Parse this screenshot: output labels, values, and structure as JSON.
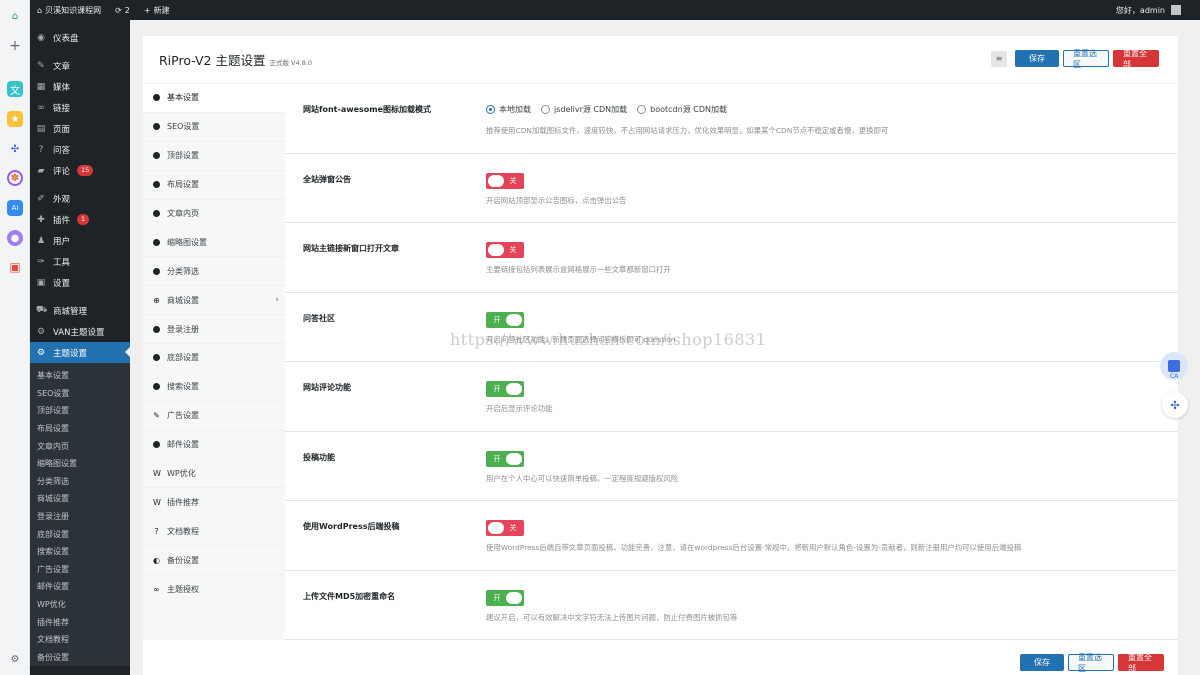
{
  "adminbar": {
    "home_icon": "home-icon",
    "site_name": "贝溪知识课程网",
    "updates_count": "2",
    "new_label": "新建",
    "greeting": "您好，admin"
  },
  "dock": {
    "icons": [
      "home-icon",
      "plus-icon",
      "translate-icon",
      "star-icon",
      "network-icon",
      "palette-icon",
      "ai-icon",
      "chat-icon",
      "game-icon",
      "settings-icon"
    ]
  },
  "menu": {
    "dashboard": "仪表盘",
    "posts": "文章",
    "media": "媒体",
    "links": "链接",
    "pages": "页面",
    "qa": "问答",
    "comments": "评论",
    "comments_badge": "15",
    "appearance": "外观",
    "plugins": "插件",
    "plugins_badge": "1",
    "users": "用户",
    "tools": "工具",
    "settings": "设置",
    "shop": "商城管理",
    "van": "VAN主题设置",
    "theme": "主题设置",
    "submenu": [
      "基本设置",
      "SEO设置",
      "顶部设置",
      "布局设置",
      "文章内页",
      "缩略图设置",
      "分类筛选",
      "商城设置",
      "登录注册",
      "底部设置",
      "搜索设置",
      "广告设置",
      "邮件设置",
      "WP优化",
      "插件推荐",
      "文档教程",
      "备份设置"
    ]
  },
  "panel": {
    "title": "RiPro-V2 主题设置",
    "version": "正式版 V4.8.0",
    "save_label": "保存",
    "reset_section_label": "重置选区",
    "reset_all_label": "重置全部"
  },
  "nav": {
    "items": [
      {
        "label": "基本设置",
        "glyph": "●"
      },
      {
        "label": "SEO设置",
        "glyph": "●"
      },
      {
        "label": "顶部设置",
        "glyph": "●"
      },
      {
        "label": "布局设置",
        "glyph": "●"
      },
      {
        "label": "文章内页",
        "glyph": "●"
      },
      {
        "label": "缩略图设置",
        "glyph": "●"
      },
      {
        "label": "分类筛选",
        "glyph": "●"
      },
      {
        "label": "商城设置",
        "glyph": "⊕"
      },
      {
        "label": "登录注册",
        "glyph": "●"
      },
      {
        "label": "底部设置",
        "glyph": "●"
      },
      {
        "label": "搜索设置",
        "glyph": "●"
      },
      {
        "label": "广告设置",
        "glyph": "✎"
      },
      {
        "label": "邮件设置",
        "glyph": "●"
      },
      {
        "label": "WP优化",
        "glyph": "W"
      },
      {
        "label": "插件推荐",
        "glyph": "W"
      },
      {
        "label": "文档教程",
        "glyph": "?"
      },
      {
        "label": "备份设置",
        "glyph": "◐"
      },
      {
        "label": "主题授权",
        "glyph": "∞"
      }
    ]
  },
  "settings": {
    "fa": {
      "label": "网站font-awesome图标加载模式",
      "options": [
        "本地加载",
        "jsdelivr源 CDN加载",
        "bootcdn源 CDN加载"
      ],
      "selected": "本地加载",
      "desc": "推荐使用CDN加载图标文件，速度较快，不占用网站请求压力，优化效果明显，如果某个CDN节点不稳定或者慢，更换即可"
    },
    "popup": {
      "label": "全站弹窗公告",
      "state": "关",
      "desc": "开启网站顶部显示公告图标，点击弹出公告"
    },
    "newwin": {
      "label": "网站主链接新窗口打开文章",
      "state": "关",
      "desc": "主要链接包括列表展示盒网格展示一些文章都新窗口打开"
    },
    "qa": {
      "label": "问答社区",
      "state": "开",
      "desc": "开启问答社区功能，新建页面选择问答模板即可 question"
    },
    "comment": {
      "label": "网站评论功能",
      "state": "开",
      "desc": "开启后显示评论功能"
    },
    "submit": {
      "label": "投稿功能",
      "state": "开",
      "desc": "用户在个人中心可以快速简单投稿，一定程度规避版权风险"
    },
    "wpsubmit": {
      "label": "使用WordPress后端投稿",
      "state": "关",
      "desc": "使用WordPress后端自带文章页面投稿，功能完善，注意，请在wordpress后台设置-常规中，将新用户默认角色-设置为-贡献者，则新注册用户均可以使用后端投稿"
    },
    "md5": {
      "label": "上传文件MD5加密重命名",
      "state": "开",
      "desc": "建议开启，可以有效解决中文字符无法上传图片问题，防止付费图片被抓包等"
    }
  },
  "watermark": "https://www.huzhan.com/ishop16831",
  "float": {
    "ai_label": "CA"
  }
}
